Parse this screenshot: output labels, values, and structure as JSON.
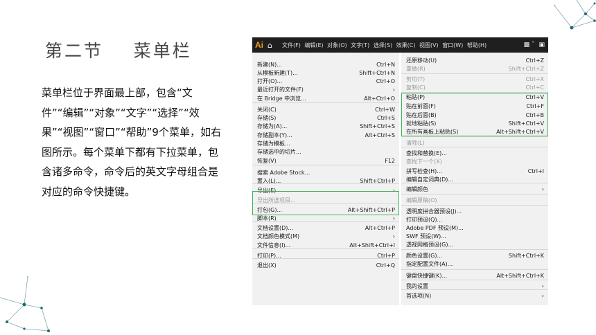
{
  "slide": {
    "title": "第二节    菜单栏",
    "body": "菜单栏位于界面最上部，包含“文件”“编辑”“对象”“文字”“选择”“效果”“视图”“窗口”“帮助”9个菜单，如右图所示。每个菜单下都有下拉菜单，包含诸多命令，命令后的英文字母组合是对应的命令快捷键。"
  },
  "appbar": {
    "logo": "Ai",
    "menus": [
      "文件(F)",
      "编辑(E)",
      "对象(O)",
      "文字(T)",
      "选择(S)",
      "效果(C)",
      "视图(V)",
      "窗口(W)",
      "帮助(H)"
    ]
  },
  "file_menu": [
    {
      "label": "新建(N)...",
      "shortcut": "Ctrl+N",
      "disabled": false
    },
    {
      "label": "从模板新建(T)...",
      "shortcut": "Shift+Ctrl+N",
      "disabled": false
    },
    {
      "label": "打开(O)...",
      "shortcut": "Ctrl+O",
      "disabled": false
    },
    {
      "label": "最近打开的文件(F)",
      "shortcut": "›",
      "disabled": false
    },
    {
      "label": "在 Bridge 中浏览...",
      "shortcut": "Alt+Ctrl+O",
      "disabled": false
    },
    {
      "label": "关闭(C)",
      "shortcut": "Ctrl+W",
      "disabled": false
    },
    {
      "label": "存储(S)",
      "shortcut": "Ctrl+S",
      "disabled": false
    },
    {
      "label": "存储为(A)...",
      "shortcut": "Shift+Ctrl+S",
      "disabled": false
    },
    {
      "label": "存储副本(Y)...",
      "shortcut": "Alt+Ctrl+S",
      "disabled": false
    },
    {
      "label": "存储为模板...",
      "shortcut": "",
      "disabled": false
    },
    {
      "label": "存储选中的切片...",
      "shortcut": "",
      "disabled": false
    },
    {
      "label": "恢复(V)",
      "shortcut": "F12",
      "disabled": false
    },
    {
      "label": "搜索 Adobe Stock...",
      "shortcut": "",
      "disabled": false
    },
    {
      "label": "置入(L)...",
      "shortcut": "Shift+Ctrl+P",
      "disabled": false
    },
    {
      "label": "导出(E)",
      "shortcut": "›",
      "disabled": false
    },
    {
      "label": "导出所选项目...",
      "shortcut": "",
      "disabled": true
    },
    {
      "label": "打包(G)...",
      "shortcut": "Alt+Shift+Ctrl+P",
      "disabled": false
    },
    {
      "label": "脚本(R)",
      "shortcut": "›",
      "disabled": false
    },
    {
      "label": "文档设置(D)...",
      "shortcut": "Alt+Ctrl+P",
      "disabled": false
    },
    {
      "label": "文档颜色模式(M)",
      "shortcut": "›",
      "disabled": false
    },
    {
      "label": "文件信息(I)...",
      "shortcut": "Alt+Shift+Ctrl+I",
      "disabled": false
    },
    {
      "label": "打印(P)...",
      "shortcut": "Ctrl+P",
      "disabled": false
    },
    {
      "label": "退出(X)",
      "shortcut": "Ctrl+Q",
      "disabled": false
    }
  ],
  "edit_menu": [
    {
      "label": "还原移动(U)",
      "shortcut": "Ctrl+Z",
      "disabled": false
    },
    {
      "label": "重做(R)",
      "shortcut": "Shift+Ctrl+Z",
      "disabled": true
    },
    {
      "label": "剪切(T)",
      "shortcut": "Ctrl+X",
      "disabled": true
    },
    {
      "label": "复制(C)",
      "shortcut": "Ctrl+C",
      "disabled": true
    },
    {
      "label": "粘贴(P)",
      "shortcut": "Ctrl+V",
      "disabled": false
    },
    {
      "label": "贴在前面(F)",
      "shortcut": "Ctrl+F",
      "disabled": false
    },
    {
      "label": "贴在后面(B)",
      "shortcut": "Ctrl+B",
      "disabled": false
    },
    {
      "label": "就地粘贴(S)",
      "shortcut": "Shift+Ctrl+V",
      "disabled": false
    },
    {
      "label": "在所有画板上粘贴(S)",
      "shortcut": "Alt+Shift+Ctrl+V",
      "disabled": false
    },
    {
      "label": "清除(L)",
      "shortcut": "",
      "disabled": true
    },
    {
      "label": "查找和替换(E)...",
      "shortcut": "",
      "disabled": false
    },
    {
      "label": "查找下一个(X)",
      "shortcut": "",
      "disabled": true
    },
    {
      "label": "拼写检查(H)...",
      "shortcut": "Ctrl+I",
      "disabled": false
    },
    {
      "label": "编辑自定词典(D)...",
      "shortcut": "",
      "disabled": false
    },
    {
      "label": "编辑颜色",
      "shortcut": "›",
      "disabled": false
    },
    {
      "label": "编辑原稿(O)",
      "shortcut": "",
      "disabled": true
    },
    {
      "label": "透明度拼合器预设(J)...",
      "shortcut": "",
      "disabled": false
    },
    {
      "label": "打印预设(Q)...",
      "shortcut": "",
      "disabled": false
    },
    {
      "label": "Adobe PDF 预设(M)...",
      "shortcut": "",
      "disabled": false
    },
    {
      "label": "SWF 预设(W)...",
      "shortcut": "",
      "disabled": false
    },
    {
      "label": "透视网格预设(G)...",
      "shortcut": "",
      "disabled": false
    },
    {
      "label": "颜色设置(G)...",
      "shortcut": "Shift+Ctrl+K",
      "disabled": false
    },
    {
      "label": "指定配置文件(A)...",
      "shortcut": "",
      "disabled": false
    },
    {
      "label": "键盘快捷键(K)...",
      "shortcut": "Alt+Shift+Ctrl+K",
      "disabled": false
    },
    {
      "label": "我的设置",
      "shortcut": "›",
      "disabled": false
    },
    {
      "label": "首选项(N)",
      "shortcut": "›",
      "disabled": false
    }
  ]
}
